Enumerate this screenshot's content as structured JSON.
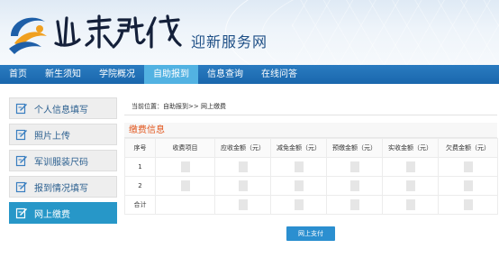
{
  "header": {
    "brand_name": "山东现代",
    "subtitle": "迎新服务网"
  },
  "nav": {
    "items": [
      {
        "label": "首页",
        "active": false
      },
      {
        "label": "新生须知",
        "active": false
      },
      {
        "label": "学院概况",
        "active": false
      },
      {
        "label": "自助报到",
        "active": true
      },
      {
        "label": "信息查询",
        "active": false
      },
      {
        "label": "在线问答",
        "active": false
      }
    ]
  },
  "sidebar": {
    "items": [
      {
        "label": "个人信息填写",
        "icon": "edit-icon",
        "active": false
      },
      {
        "label": "照片上传",
        "icon": "edit-icon",
        "active": false
      },
      {
        "label": "军训服装尺码",
        "icon": "edit-icon",
        "active": false
      },
      {
        "label": "报到情况填写",
        "icon": "edit-icon",
        "active": false
      },
      {
        "label": "网上缴费",
        "icon": "edit-icon",
        "active": true
      }
    ]
  },
  "main": {
    "breadcrumb": "当前位置：自助报到>> 网上缴费",
    "section_title": "缴费信息",
    "table": {
      "columns": [
        "序号",
        "收费项目",
        "应收金额（元）",
        "减免金额（元）",
        "预缴金额（元）",
        "实收金额（元）",
        "欠费金额（元）"
      ],
      "rows": [
        {
          "index": "1"
        },
        {
          "index": "2"
        },
        {
          "index": "合计"
        }
      ]
    },
    "pay_button_label": "网上支付"
  },
  "colors": {
    "nav_bg": "#1a67ad",
    "nav_active": "#52b2e2",
    "sidebar_active": "#2797c8",
    "section_title": "#e2571f",
    "button": "#2b8fd0"
  }
}
